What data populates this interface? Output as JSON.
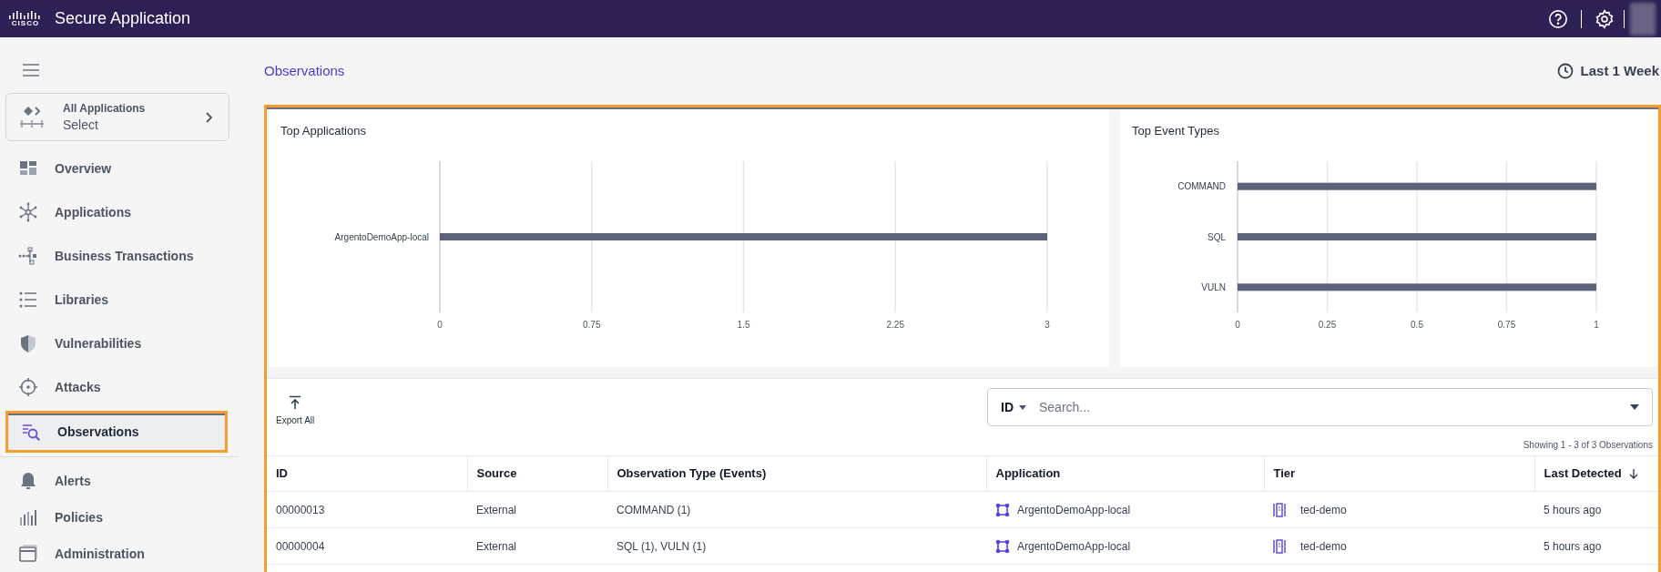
{
  "top_bar": {
    "logo_text": "CISCO",
    "title": "Secure Application"
  },
  "sidebar": {
    "app_selector": {
      "label": "All Applications",
      "value": "Select"
    },
    "sections": [
      {
        "items": [
          {
            "label": "Overview",
            "selected": false
          },
          {
            "label": "Applications",
            "selected": false
          },
          {
            "label": "Business Transactions",
            "selected": false
          },
          {
            "label": "Libraries",
            "selected": false
          },
          {
            "label": "Vulnerabilities",
            "selected": false
          },
          {
            "label": "Attacks",
            "selected": false
          },
          {
            "label": "Observations",
            "selected": true
          }
        ]
      },
      {
        "items": [
          {
            "label": "Alerts",
            "selected": false
          },
          {
            "label": "Policies",
            "selected": false
          },
          {
            "label": "Administration",
            "selected": false
          }
        ]
      }
    ]
  },
  "page": {
    "title": "Observations",
    "time_range": "Last 1 Week"
  },
  "charts": [
    {
      "chart_data": {
        "type": "bar",
        "orientation": "horizontal",
        "title": "Top Applications",
        "categories": [
          "ArgentoDemoApp-local"
        ],
        "values": [
          3
        ],
        "xlim": [
          0,
          3
        ],
        "grid": true,
        "xticks": [
          0,
          {
            "value": 0.75,
            "label": "0.75"
          },
          {
            "value": 1.5,
            "label": "1.5"
          },
          {
            "value": 2.25,
            "label": "2.25"
          },
          3
        ]
      }
    },
    {
      "chart_data": {
        "type": "bar",
        "orientation": "horizontal",
        "title": "Top Event Types",
        "categories": [
          "COMMAND",
          "SQL",
          "VULN"
        ],
        "values": [
          1,
          1,
          1
        ],
        "xlim": [
          0,
          1
        ],
        "grid": true,
        "xticks": [
          0,
          {
            "value": 0.25,
            "label": "0.25"
          },
          {
            "value": 0.5,
            "label": "0.5"
          },
          {
            "value": 0.75,
            "label": "0.75"
          },
          1
        ]
      }
    }
  ],
  "toolbar": {
    "export_label": "Export All",
    "search_scope": "ID",
    "search_placeholder": "Search...",
    "result_count": "Showing 1 - 3 of 3 Observations"
  },
  "table": {
    "columns": [
      {
        "label": "ID",
        "kind": "text",
        "sorted": false
      },
      {
        "label": "Source",
        "kind": "text",
        "sorted": false
      },
      {
        "label": "Observation Type (Events)",
        "kind": "text",
        "sorted": false
      },
      {
        "label": "Application",
        "kind": "app",
        "sorted": false
      },
      {
        "label": "Tier",
        "kind": "tier",
        "sorted": false
      },
      {
        "label": "Last Detected",
        "kind": "text",
        "sorted": true
      }
    ],
    "rows": [
      [
        "00000013",
        "External",
        "COMMAND (1)",
        "ArgentoDemoApp-local",
        "ted-demo",
        "5 hours ago"
      ],
      [
        "00000004",
        "External",
        "SQL (1), VULN (1)",
        "ArgentoDemoApp-local",
        "ted-demo",
        "5 hours ago"
      ]
    ]
  }
}
